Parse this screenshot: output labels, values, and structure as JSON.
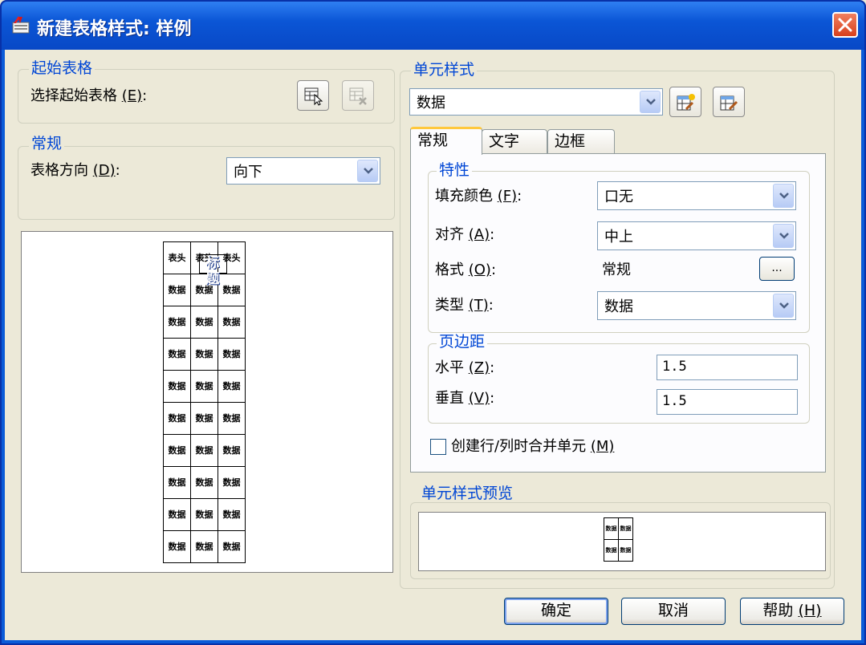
{
  "window": {
    "title": "新建表格样式: 样例"
  },
  "start_table": {
    "group_label": "起始表格",
    "select_label": "选择起始表格",
    "select_key": "(E)",
    "select_suffix": ":"
  },
  "general": {
    "group_label": "常规",
    "direction_label": "表格方向",
    "direction_key": "(D)",
    "direction_suffix": ":",
    "direction_value": "向下"
  },
  "table_preview": {
    "title": "标题",
    "header_cell": "表头",
    "data_cell": "数据",
    "data_rows": 9
  },
  "cell_styles": {
    "group_label": "单元样式",
    "selected": "数据",
    "tabs": [
      "常规",
      "文字",
      "边框"
    ],
    "properties": {
      "group_label": "特性",
      "fill_color_label": "填充颜色",
      "fill_color_key": "(F)",
      "fill_color_value": "口无",
      "align_label": "对齐",
      "align_key": "(A)",
      "align_value": "中上",
      "format_label": "格式",
      "format_key": "(O)",
      "format_value": "常规",
      "format_button": "...",
      "type_label": "类型",
      "type_key": "(T)",
      "type_value": "数据",
      "suffix": ":"
    },
    "margins": {
      "group_label": "页边距",
      "horizontal_label": "水平",
      "horizontal_key": "(Z)",
      "horizontal_value": "1.5",
      "vertical_label": "垂直",
      "vertical_key": "(V)",
      "vertical_value": "1.5",
      "suffix": ":"
    },
    "merge_checkbox_label": "创建行/列时合并单元",
    "merge_checkbox_key": "(M)",
    "merge_checked": false
  },
  "cell_style_preview": {
    "group_label": "单元样式预览",
    "data_cell": "数据"
  },
  "buttons": {
    "ok": "确定",
    "cancel": "取消",
    "help": "帮助",
    "help_key": "(H)"
  }
}
